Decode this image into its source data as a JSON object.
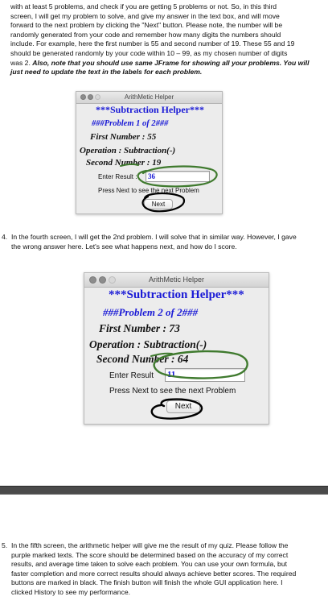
{
  "intro": {
    "lines": [
      "with at least 5 problems, and check if you are getting 5 problems or not. So, in this third",
      "screen, I will get my problem to solve, and give my answer in the text box, and will move",
      "forward to the next problem by clicking the \"Next\" button. Please note, the number will be",
      "randomly generated from your code and remember how many digits the numbers should",
      "include. For example, here the first number is 55 and second number of 19. These 55 and 19",
      "should be generated randomly by your code within 10 – 99, as my chosen number of digits",
      "was 2. "
    ],
    "emphasis_line7": "Also, note that you should use same JFrame for showing all your problems. You will",
    "emphasis_line8": "just need to update the text in the labels for each problem."
  },
  "window1": {
    "title": "ArithMetic Helper",
    "header": "***Subtraction Helper***",
    "problem": "###Problem 1 of 2###",
    "first_number": "First Number : 55",
    "operation": "Operation :  Subtraction(-)",
    "second_number": "Second Number : 19",
    "enter_label": "Enter Result :",
    "input_value": "36",
    "press_next": "Press Next to see the next Problem",
    "next_button": "Next"
  },
  "step4": {
    "number": "4.",
    "line1": "In the fourth screen, I will get the 2nd problem. I will solve that in similar way. However, I gave",
    "line2": "the wrong answer here. Let's see what happens next, and how do I score."
  },
  "window2": {
    "title": "ArithMetic Helper",
    "header": "***Subtraction Helper***",
    "problem": "###Problem 2 of 2###",
    "first_number": "First Number : 73",
    "operation": "Operation :  Subtraction(-)",
    "second_number": "Second Number : 64",
    "enter_label": "Enter Result",
    "input_value": "11",
    "press_next": "Press Next to see the next Problem",
    "next_button": "Next"
  },
  "step5": {
    "number": "5.",
    "lines": [
      "In the fifth screen, the arithmetic helper will give me the result of my quiz. Please follow the",
      "purple marked texts. The score should be determined based on the accuracy of my correct",
      "results, and average time taken to solve each problem. You can use your own formula, but",
      "faster completion and more correct results should always achieve better scores. The required",
      "buttons are marked in black. The finish button will finish the whole GUI application here. I",
      "clicked History to see my performance."
    ]
  },
  "colors": {
    "header_blue": "#1a1ad6",
    "annotation_green": "#3f7a2e",
    "annotation_black": "#000000"
  }
}
